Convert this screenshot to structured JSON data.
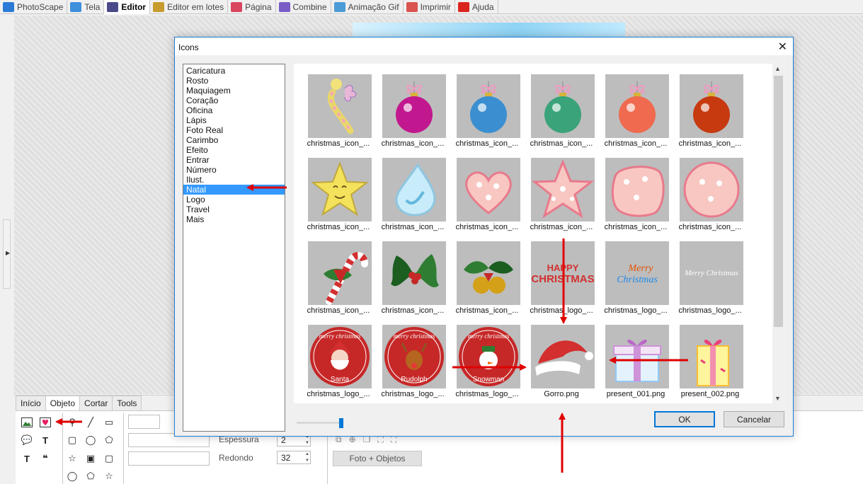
{
  "top_tabs": [
    {
      "label": "PhotoScape",
      "active": false
    },
    {
      "label": "Tela",
      "active": false
    },
    {
      "label": "Editor",
      "active": true
    },
    {
      "label": "Editor em lotes",
      "active": false
    },
    {
      "label": "Página",
      "active": false
    },
    {
      "label": "Combine",
      "active": false
    },
    {
      "label": "Animação Gif",
      "active": false
    },
    {
      "label": "Imprimir",
      "active": false
    },
    {
      "label": "Ajuda",
      "active": false
    }
  ],
  "bottom_tabs": [
    "Início",
    "Objeto",
    "Cortar",
    "Tools"
  ],
  "bottom_active_tab": "Objeto",
  "bottom_controls": {
    "thickness_label": "Espessura",
    "thickness_value": "2",
    "round_label": "Redondo",
    "round_value": "32",
    "photo_objects_button": "Foto + Objetos"
  },
  "dialog": {
    "title": "Icons",
    "close_glyph": "✕",
    "categories": [
      "Caricatura",
      "Rosto",
      "Maquiagem",
      "Coração",
      "Oficina",
      "Lápis",
      "Foto Real",
      "Carimbo",
      "Efeito",
      "Entrar",
      "Número",
      "Ilust.",
      "Natal",
      "Logo",
      "Travel",
      "Mais"
    ],
    "selected_category": "Natal",
    "icons": [
      {
        "caption": "christmas_icon_...",
        "art": "candy"
      },
      {
        "caption": "christmas_icon_...",
        "art": "ornament",
        "color": "#c2188f"
      },
      {
        "caption": "christmas_icon_...",
        "art": "ornament",
        "color": "#3b8fd0"
      },
      {
        "caption": "christmas_icon_...",
        "art": "ornament",
        "color": "#3aa37a"
      },
      {
        "caption": "christmas_icon_...",
        "art": "ornament",
        "color": "#ef6a4e"
      },
      {
        "caption": "christmas_icon_...",
        "art": "ornament",
        "color": "#c73a10"
      },
      {
        "caption": "christmas_icon_...",
        "art": "star_face"
      },
      {
        "caption": "christmas_icon_...",
        "art": "drop"
      },
      {
        "caption": "christmas_icon_...",
        "art": "heart"
      },
      {
        "caption": "christmas_icon_...",
        "art": "star_pink"
      },
      {
        "caption": "christmas_icon_...",
        "art": "blob"
      },
      {
        "caption": "christmas_icon_...",
        "art": "circle_pink"
      },
      {
        "caption": "christmas_icon_...",
        "art": "candycane"
      },
      {
        "caption": "christmas_icon_...",
        "art": "holly"
      },
      {
        "caption": "christmas_icon_...",
        "art": "holly_bells"
      },
      {
        "caption": "christmas_logo_...",
        "art": "text_logo",
        "text1": "HAPPY",
        "text2": "CHRISTMAS"
      },
      {
        "caption": "christmas_logo_...",
        "art": "text_logo2",
        "text1": "Merry",
        "text2": "Christmas"
      },
      {
        "caption": "christmas_logo_...",
        "art": "text_logo3",
        "text1": "Merry Christmas"
      },
      {
        "caption": "christmas_logo_...",
        "art": "badge",
        "kind": "santa",
        "arc": "merry christmas",
        "name": "Santa"
      },
      {
        "caption": "christmas_logo_...",
        "art": "badge",
        "kind": "rudolph",
        "arc": "merry christmas",
        "name": "Rudolph"
      },
      {
        "caption": "christmas_logo_...",
        "art": "badge",
        "kind": "snowman",
        "arc": "merry christmas",
        "name": "Snowman"
      },
      {
        "caption": "Gorro.png",
        "art": "hat"
      },
      {
        "caption": "present_001.png",
        "art": "present1"
      },
      {
        "caption": "present_002.png",
        "art": "present2"
      }
    ],
    "ok_label": "OK",
    "cancel_label": "Cancelar"
  }
}
